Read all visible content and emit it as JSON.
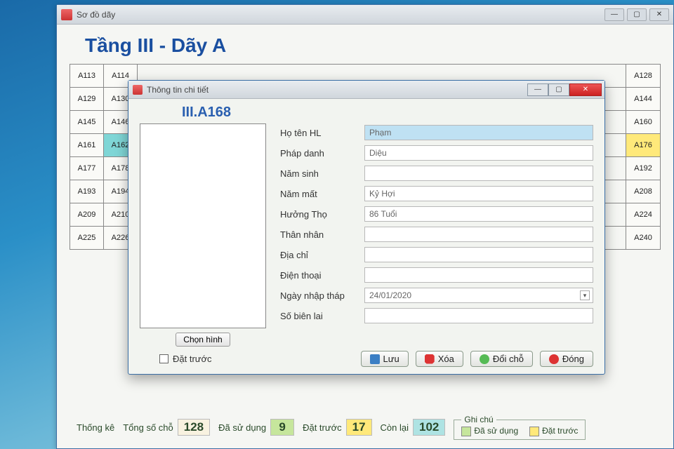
{
  "parent_window": {
    "title": "Sơ đồ dãy"
  },
  "page_title": "Tầng III - Dãy A",
  "grid_left": [
    [
      "A113",
      "A114"
    ],
    [
      "A129",
      "A130"
    ],
    [
      "A145",
      "A146"
    ],
    [
      "A161",
      "A162"
    ],
    [
      "A177",
      "A178"
    ],
    [
      "A193",
      "A194"
    ],
    [
      "A209",
      "A210"
    ],
    [
      "A225",
      "A226"
    ]
  ],
  "grid_right": [
    "A128",
    "A144",
    "A160",
    "A176",
    "A192",
    "A208",
    "A224",
    "A240"
  ],
  "selected_cell": "A162",
  "reserved_cell": "A176",
  "stats": {
    "group_label": "Thống kê",
    "total_label": "Tổng số chỗ",
    "total": "128",
    "used_label": "Đã sử dụng",
    "used": "9",
    "pre_label": "Đặt trước",
    "pre": "17",
    "remain_label": "Còn lại",
    "remain": "102",
    "legend_label": "Ghi chú",
    "legend_used": "Đã sử dụng",
    "legend_reserved": "Đặt trước"
  },
  "modal": {
    "title": "Thông tin chi tiết",
    "slot_code": "III.A168",
    "photo_button": "Chọn hình",
    "fields": {
      "name_label": "Họ tên HL",
      "name_value": "Phạm",
      "dharma_label": "Pháp danh",
      "dharma_value": "Diệu",
      "birth_label": "Năm sinh",
      "birth_value": "",
      "death_label": "Năm mất",
      "death_value": "Kỷ Hợi",
      "age_label": "Hưởng Thọ",
      "age_value": "86 Tuổi",
      "relative_label": "Thân nhân",
      "relative_value": "",
      "address_label": "Địa chỉ",
      "address_value": "",
      "phone_label": "Điện thoại",
      "phone_value": "",
      "date_label": "Ngày nhập tháp",
      "date_value": "24/01/2020",
      "receipt_label": "Số biên lai",
      "receipt_value": ""
    },
    "reserve_checkbox": "Đặt trước",
    "buttons": {
      "save": "Lưu",
      "delete": "Xóa",
      "swap": "Đổi chỗ",
      "close": "Đóng"
    }
  }
}
